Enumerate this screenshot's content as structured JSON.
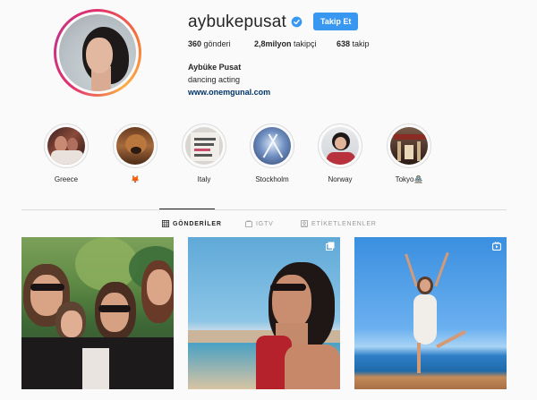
{
  "profile": {
    "username": "aybukepusat",
    "follow_label": "Takip Et",
    "stats": {
      "posts_count": "360",
      "posts_label": "gönderi",
      "followers_count": "2,8milyon",
      "followers_label": "takipçi",
      "following_count": "638",
      "following_label": "takip"
    },
    "full_name": "Aybüke Pusat",
    "bio": "dancing acting",
    "website": "www.onemgunal.com"
  },
  "highlights": [
    {
      "label": "Greece"
    },
    {
      "label": "🦊"
    },
    {
      "label": "Italy"
    },
    {
      "label": "Stockholm"
    },
    {
      "label": "Norway"
    },
    {
      "label": "Tokyo🏯"
    }
  ],
  "tabs": [
    {
      "label": "GÖNDERİLER",
      "icon": "grid-icon",
      "active": true
    },
    {
      "label": "IGTV",
      "icon": "igtv-icon",
      "active": false
    },
    {
      "label": "ETİKETLENENLER",
      "icon": "tagged-icon",
      "active": false
    }
  ],
  "posts": [
    {
      "type": "image",
      "icon": "none"
    },
    {
      "type": "carousel",
      "icon": "multiple-photos-icon"
    },
    {
      "type": "igtv",
      "icon": "igtv-icon"
    }
  ],
  "colors": {
    "background": "#fafafa",
    "accent": "#3897f0",
    "link": "#003569",
    "text": "#262626",
    "muted": "#999999",
    "border": "#dbdbdb"
  }
}
